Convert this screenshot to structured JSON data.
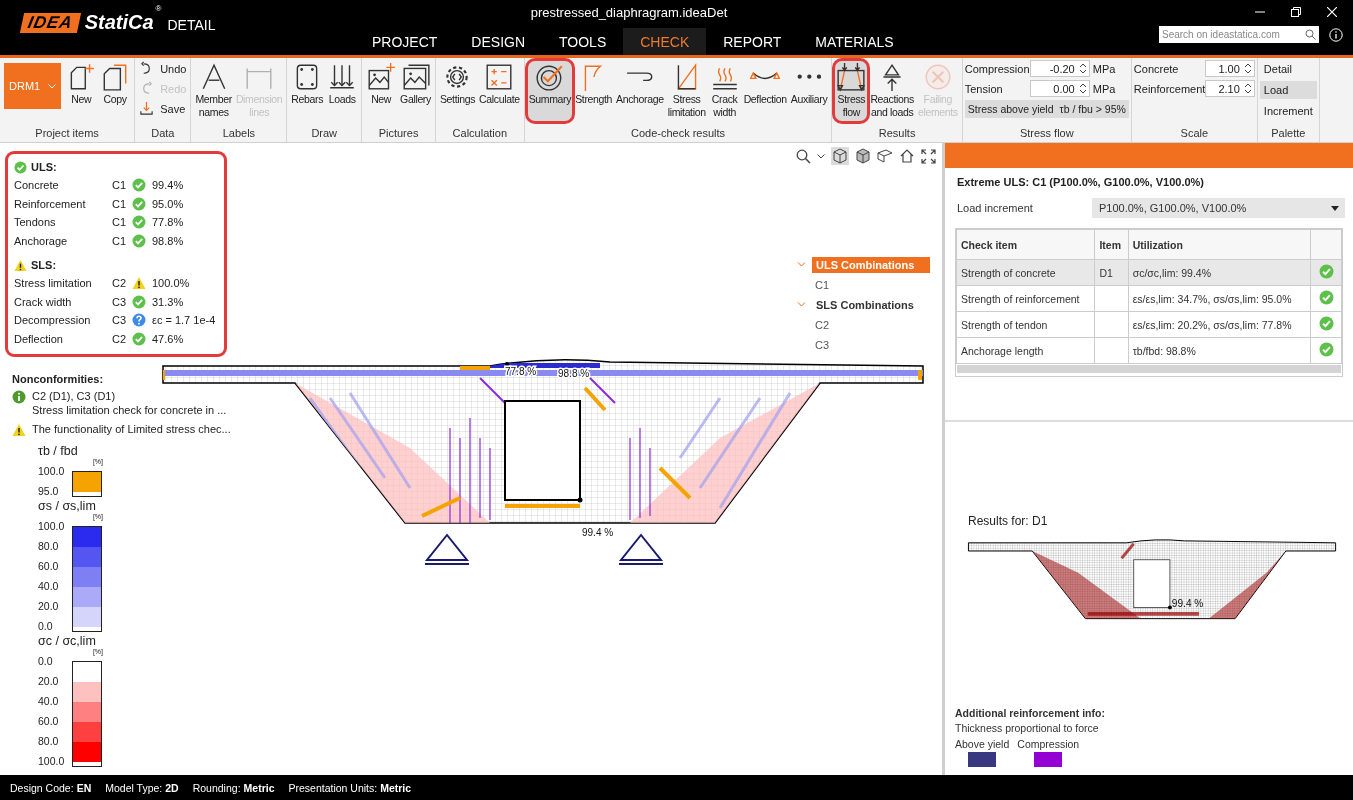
{
  "window": {
    "title": "prestressed_diaphragram.ideaDet",
    "logo": {
      "brand": "IDEA",
      "name": "StatiCa",
      "mark": "®",
      "product": "DETAIL"
    },
    "search": {
      "placeholder": "Search on ideastatica.com"
    }
  },
  "menu": [
    {
      "label": "PROJECT",
      "selected": false
    },
    {
      "label": "DESIGN",
      "selected": false
    },
    {
      "label": "TOOLS",
      "selected": false
    },
    {
      "label": "CHECK",
      "selected": true
    },
    {
      "label": "REPORT",
      "selected": false
    },
    {
      "label": "MATERIALS",
      "selected": false
    }
  ],
  "ribbon": {
    "groups": [
      {
        "label": "Project items",
        "items": [
          {
            "kind": "dropdown",
            "label": "DRM1"
          },
          {
            "kind": "large",
            "label": "New",
            "selected": false,
            "disabled": false,
            "highlighted": false
          },
          {
            "kind": "large",
            "label": "Copy",
            "selected": false,
            "disabled": false,
            "highlighted": false
          }
        ]
      },
      {
        "label": "Data",
        "items": [
          {
            "kind": "small",
            "label": "Undo",
            "disabled": false
          },
          {
            "kind": "small",
            "label": "Redo",
            "disabled": true
          },
          {
            "kind": "small",
            "label": "Save",
            "disabled": false
          }
        ]
      },
      {
        "label": "Labels",
        "items": [
          {
            "kind": "large",
            "label": "Member names",
            "selected": false,
            "disabled": false,
            "highlighted": false
          },
          {
            "kind": "large",
            "label": "Dimension lines",
            "selected": false,
            "disabled": true,
            "highlighted": false
          }
        ]
      },
      {
        "label": "Draw",
        "items": [
          {
            "kind": "large",
            "label": "Rebars",
            "selected": false,
            "disabled": false,
            "highlighted": false
          },
          {
            "kind": "large",
            "label": "Loads",
            "selected": false,
            "disabled": false,
            "highlighted": false
          }
        ]
      },
      {
        "label": "Pictures",
        "items": [
          {
            "kind": "large",
            "label": "New",
            "selected": false,
            "disabled": false,
            "highlighted": false
          },
          {
            "kind": "large",
            "label": "Gallery",
            "selected": false,
            "disabled": false,
            "highlighted": false
          }
        ]
      },
      {
        "label": "Calculation",
        "items": [
          {
            "kind": "large",
            "label": "Settings",
            "selected": false,
            "disabled": false,
            "highlighted": false
          },
          {
            "kind": "large",
            "label": "Calculate",
            "selected": false,
            "disabled": false,
            "highlighted": false
          }
        ]
      },
      {
        "label": "Code-check results",
        "items": [
          {
            "kind": "large",
            "label": "Summary",
            "selected": true,
            "disabled": false,
            "highlighted": true
          },
          {
            "kind": "large",
            "label": "Strength",
            "selected": false,
            "disabled": false,
            "highlighted": false
          },
          {
            "kind": "large",
            "label": "Anchorage",
            "selected": false,
            "disabled": false,
            "highlighted": false
          },
          {
            "kind": "large",
            "label": "Stress limitation",
            "selected": false,
            "disabled": false,
            "highlighted": false
          },
          {
            "kind": "large",
            "label": "Crack width",
            "selected": false,
            "disabled": false,
            "highlighted": false
          },
          {
            "kind": "large",
            "label": "Deflection",
            "selected": false,
            "disabled": false,
            "highlighted": false
          },
          {
            "kind": "large",
            "label": "Auxiliary",
            "selected": false,
            "disabled": false,
            "highlighted": false
          }
        ]
      },
      {
        "label": "Results",
        "items": [
          {
            "kind": "large",
            "label": "Stress flow",
            "selected": true,
            "disabled": false,
            "highlighted": true
          },
          {
            "kind": "large",
            "label": "Reactions and loads",
            "selected": false,
            "disabled": false,
            "highlighted": false
          },
          {
            "kind": "large",
            "label": "Failing elements",
            "selected": false,
            "disabled": true,
            "highlighted": false
          }
        ]
      },
      {
        "label": "Stress flow",
        "items": [
          {
            "kind": "spin",
            "label": "Compression",
            "value": "-0.20",
            "unit": "MPa"
          },
          {
            "kind": "spin",
            "label": "Tension",
            "value": "0.00",
            "unit": "MPa"
          },
          {
            "kind": "button",
            "label": "Stress above yield"
          },
          {
            "kind": "button",
            "label": "τb / fbu > 95%"
          }
        ]
      },
      {
        "label": "Scale",
        "items": [
          {
            "kind": "spin",
            "label": "Concrete",
            "value": "1.00"
          },
          {
            "kind": "spin",
            "label": "Reinforcement",
            "value": "2.10"
          }
        ]
      },
      {
        "label": "Palette",
        "items": [
          {
            "kind": "toggle",
            "label": "Detail",
            "selected": false
          },
          {
            "kind": "toggle",
            "label": "Load",
            "selected": true
          },
          {
            "kind": "toggle",
            "label": "Increment",
            "selected": false
          }
        ]
      }
    ]
  },
  "summary": {
    "highlighted": true,
    "sections": [
      {
        "title": "ULS:",
        "kind": "ok",
        "rows": [
          {
            "name": "Concrete",
            "combination": "C1",
            "kind": "ok",
            "value": "99.4%"
          },
          {
            "name": "Reinforcement",
            "combination": "C1",
            "kind": "ok",
            "value": "95.0%"
          },
          {
            "name": "Tendons",
            "combination": "C1",
            "kind": "ok",
            "value": "77.8%"
          },
          {
            "name": "Anchorage",
            "combination": "C1",
            "kind": "ok",
            "value": "98.8%"
          }
        ]
      },
      {
        "title": "SLS:",
        "kind": "warning",
        "rows": [
          {
            "name": "Stress limitation",
            "combination": "C2",
            "kind": "warning",
            "value": "100.0%"
          },
          {
            "name": "Crack width",
            "combination": "C3",
            "kind": "ok",
            "value": "31.3%"
          },
          {
            "name": "Decompression",
            "combination": "C3",
            "kind": "question",
            "value": "εc = 1.7 1e-4"
          },
          {
            "name": "Deflection",
            "combination": "C2",
            "kind": "ok",
            "value": "47.6%"
          }
        ]
      }
    ]
  },
  "nonconformities": {
    "title": "Nonconformities:",
    "items": [
      {
        "kind": "info",
        "lines": [
          "C2 (D1), C3 (D1)",
          "Stress limitation check for concrete in ..."
        ]
      },
      {
        "kind": "warning",
        "lines": [
          "The functionality of Limited stress chec..."
        ]
      }
    ]
  },
  "legends": [
    {
      "title": "τb / fbd",
      "unit": "[%]",
      "labels": [
        "100.0",
        "95.0"
      ],
      "bands": [
        {
          "color": "#f5a300"
        }
      ]
    },
    {
      "title": "σs / σs,lim",
      "unit": "[%]",
      "labels": [
        "100.0",
        "80.0",
        "60.0",
        "40.0",
        "20.0",
        "0.0"
      ],
      "bands": [
        {
          "color": "#2b2bf0"
        },
        {
          "color": "#5555f2"
        },
        {
          "color": "#7f7ff5"
        },
        {
          "color": "#aaaaf8"
        },
        {
          "color": "#d5d5fb"
        }
      ]
    },
    {
      "title": "σc / σc,lim",
      "unit": "[%]",
      "labels": [
        "0.0",
        "20.0",
        "40.0",
        "60.0",
        "80.0",
        "100.0"
      ],
      "bands": [
        {
          "color": "#ffffff"
        },
        {
          "color": "#ffc0c0"
        },
        {
          "color": "#ff8080"
        },
        {
          "color": "#ff4040"
        },
        {
          "color": "#ff0000"
        }
      ]
    }
  ],
  "canvas": {
    "labels": [
      "77.8 %",
      "98.8 %",
      "99.4 %"
    ],
    "tree": [
      {
        "label": "ULS Combinations",
        "expanded": true,
        "selected": true,
        "children": [
          {
            "label": "C1",
            "selected": false
          }
        ]
      },
      {
        "label": "SLS Combinations",
        "expanded": true,
        "selected": false,
        "children": [
          {
            "label": "C2",
            "selected": false
          },
          {
            "label": "C3",
            "selected": false
          }
        ]
      }
    ]
  },
  "panel": {
    "title": "Extreme ULS: C1 (P100.0%, G100.0%, V100.0%)",
    "load_increment": {
      "label": "Load increment",
      "value": "P100.0%, G100.0%, V100.0%"
    },
    "table": {
      "columns": [
        "Check item",
        "Item",
        "Utilization"
      ],
      "rows": [
        {
          "cells": [
            "Strength of concrete",
            "D1",
            "σc/σc,lim: 99.4%"
          ],
          "kind": "ok",
          "selected": true
        },
        {
          "cells": [
            "Strength of reinforcement",
            "",
            "εs/εs,lim: 34.7%, σs/σs,lim: 95.0%"
          ],
          "kind": "ok",
          "selected": false
        },
        {
          "cells": [
            "Strength of tendon",
            "",
            "εs/εs,lim: 20.2%, σs/σs,lim: 77.8%"
          ],
          "kind": "ok",
          "selected": false
        },
        {
          "cells": [
            "Anchorage length",
            "",
            "τb/fbd: 98.8%"
          ],
          "kind": "ok",
          "selected": false
        }
      ]
    },
    "results": {
      "title": "Results for: D1",
      "label": "99.4 %"
    },
    "reinforcement_info": {
      "title": "Additional reinforcement info:",
      "text": "Thickness proportional to force",
      "items": [
        {
          "label": "Above yield",
          "color": "#383880"
        },
        {
          "label": "Compression",
          "color": "#9400d3"
        }
      ]
    }
  },
  "status_bar": [
    {
      "label": "Design Code:",
      "value": "EN"
    },
    {
      "label": "Model Type:",
      "value": "2D"
    },
    {
      "label": "Rounding:",
      "value": "Metric"
    },
    {
      "label": "Presentation Units:",
      "value": "Metric"
    }
  ]
}
